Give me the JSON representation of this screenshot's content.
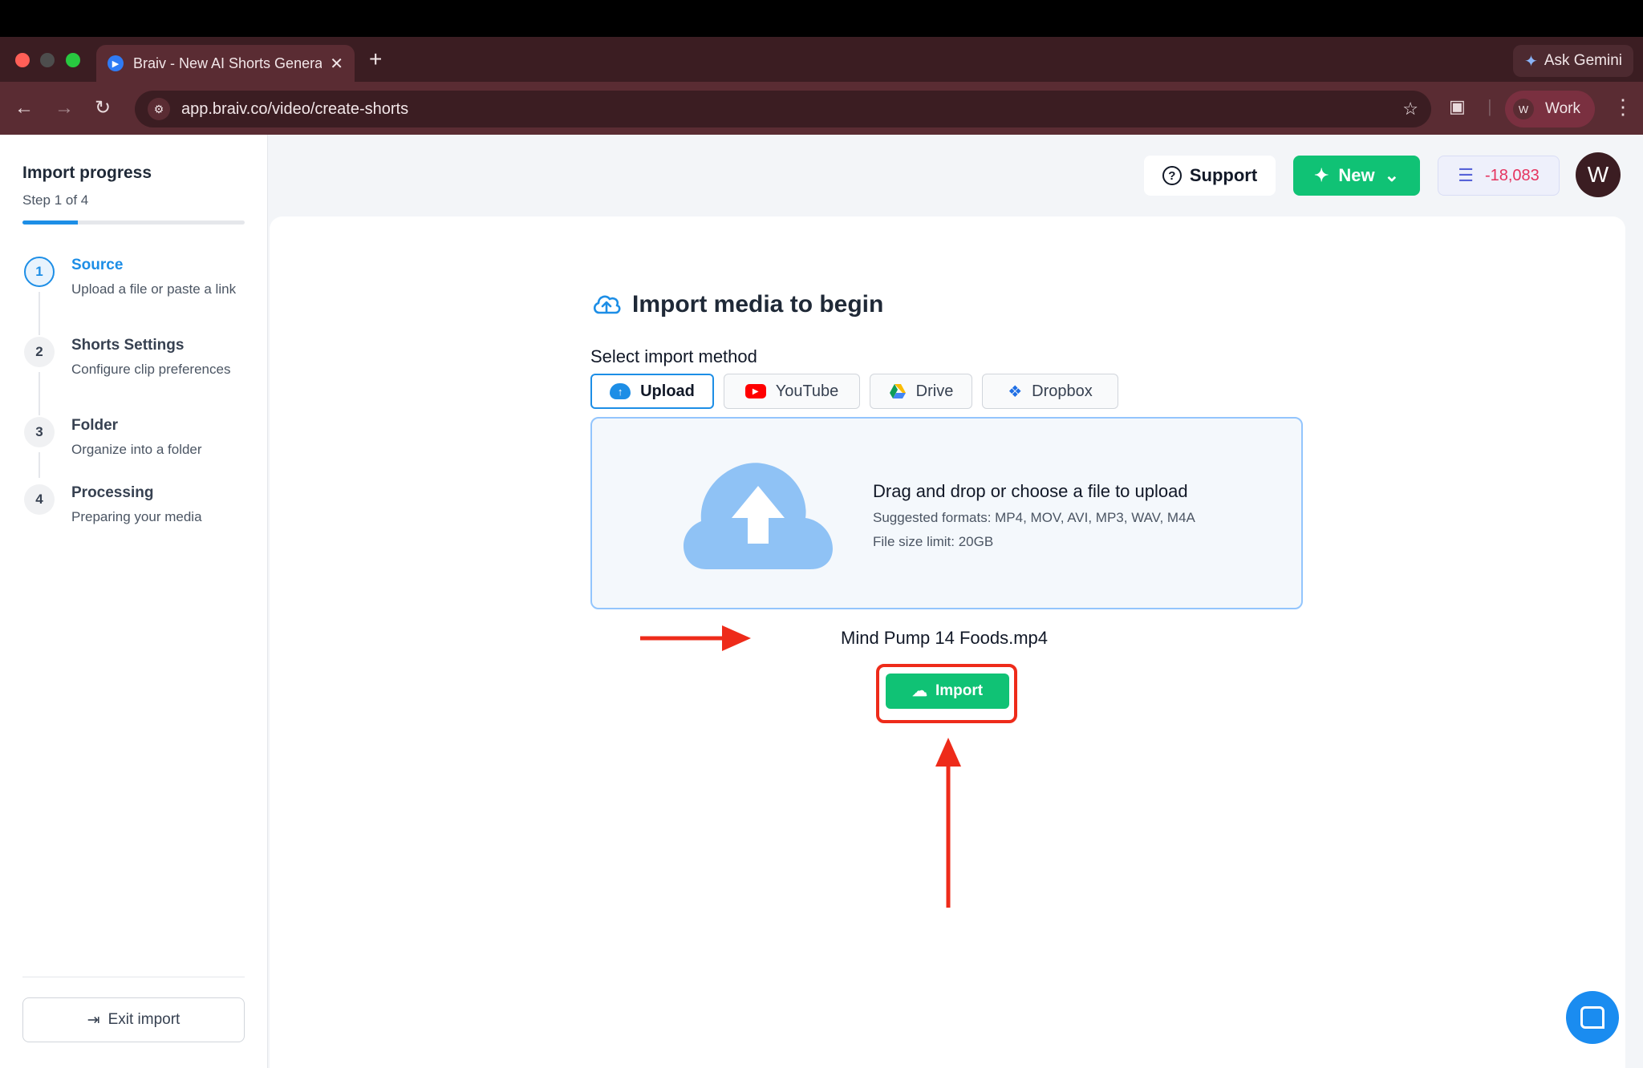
{
  "browser": {
    "tab_title": "Braiv - New AI Shorts Genera",
    "url": "app.braiv.co/video/create-shorts",
    "ask_gemini": "Ask Gemini",
    "profile_initial": "W",
    "profile_label": "Work"
  },
  "sidebar": {
    "title": "Import progress",
    "step_counter": "Step 1 of 4",
    "progress_fraction": 0.25,
    "steps": [
      {
        "num": "1",
        "title": "Source",
        "desc": "Upload a file or paste a link"
      },
      {
        "num": "2",
        "title": "Shorts Settings",
        "desc": "Configure clip preferences"
      },
      {
        "num": "3",
        "title": "Folder",
        "desc": "Organize into a folder"
      },
      {
        "num": "4",
        "title": "Processing",
        "desc": "Preparing your media"
      }
    ],
    "exit_label": "Exit import"
  },
  "header": {
    "support_label": "Support",
    "new_label": "New",
    "credits": "-18,083",
    "avatar_initial": "W"
  },
  "main": {
    "title": "Import media to begin",
    "method_label": "Select import method",
    "methods": [
      "Upload",
      "YouTube",
      "Drive",
      "Dropbox"
    ],
    "active_method": "Upload",
    "dropzone": {
      "title": "Drag and drop or choose a file to upload",
      "formats": "Suggested formats: MP4, MOV, AVI, MP3, WAV, M4A",
      "limit": "File size limit: 20GB"
    },
    "selected_file": "Mind Pump 14 Foods.mp4",
    "import_label": "Import"
  },
  "colors": {
    "accent": "#1d8ee6",
    "primary_green": "#10c275",
    "annotation_red": "#ee2b1a",
    "credits_red": "#e5335e"
  }
}
